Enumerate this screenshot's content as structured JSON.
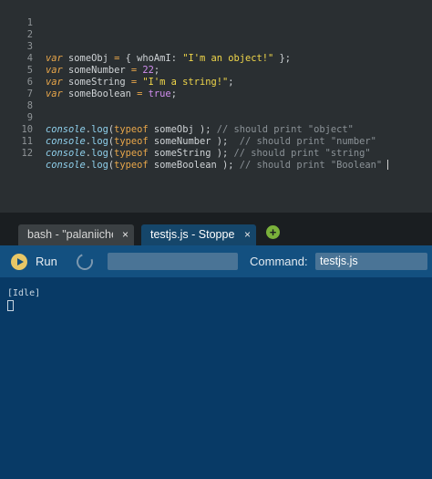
{
  "editor": {
    "lines": [
      {
        "n": "1"
      },
      {
        "n": "2"
      },
      {
        "n": "3",
        "kw": "var",
        "name": "someObj",
        "eq": " = ",
        "pre": "{ ",
        "key": "whoAmI",
        "colon": ": ",
        "val": "\"I'm an object!\"",
        "post": " };"
      },
      {
        "n": "4",
        "kw": "var",
        "name": "someNumber",
        "eq": " = ",
        "val": "22",
        "post": ";"
      },
      {
        "n": "5",
        "kw": "var",
        "name": "someString",
        "eq": " = ",
        "val": "\"I'm a string!\"",
        "post": ";"
      },
      {
        "n": "6",
        "kw": "var",
        "name": "someBoolean",
        "eq": " = ",
        "val": "true",
        "post": ";"
      },
      {
        "n": "7"
      },
      {
        "n": "8"
      },
      {
        "n": "9",
        "obj": "console",
        "dot": ".",
        "fn": "log",
        "open": "(",
        "kw": "typeof",
        "arg": " someObj ",
        "close": ");",
        "cmt": " // should print \"object\""
      },
      {
        "n": "10",
        "obj": "console",
        "dot": ".",
        "fn": "log",
        "open": "(",
        "kw": "typeof",
        "arg": " someNumber ",
        "close": ");",
        "cmt": "  // should print \"number\""
      },
      {
        "n": "11",
        "obj": "console",
        "dot": ".",
        "fn": "log",
        "open": "(",
        "kw": "typeof",
        "arg": " someString ",
        "close": ");",
        "cmt": " // should print \"string\""
      },
      {
        "n": "12",
        "obj": "console",
        "dot": ".",
        "fn": "log",
        "open": "(",
        "kw": "typeof",
        "arg": " someBoolean ",
        "close": ");",
        "cmt": " // should print \"Boolean\""
      }
    ]
  },
  "tabs": [
    {
      "label": "bash - \"palaniiche",
      "close": "×"
    },
    {
      "label": "testjs.js - Stoppe",
      "close": "×"
    }
  ],
  "new_tab": {
    "symbol": "+"
  },
  "toolbar": {
    "run_label": "Run",
    "args_value": "",
    "command_label": "Command:",
    "command_value": "testjs.js"
  },
  "console": {
    "status": "[Idle]"
  },
  "colors": {
    "editor_bg": "#2a2f32",
    "keyword": "#e8a64a",
    "string": "#f0d64a",
    "literal": "#d18ef0",
    "builtin": "#8fd0ec",
    "comment": "#8b9297",
    "toolbar_bg": "#135080",
    "console_bg": "#083a66",
    "active_tab": "#15466a",
    "run_icon": "#e8c766",
    "add_icon": "#7ab13b"
  },
  "icons": {
    "run": "play-circle-icon",
    "restart": "restart-icon",
    "add": "plus-circle-icon",
    "close": "close-icon"
  }
}
